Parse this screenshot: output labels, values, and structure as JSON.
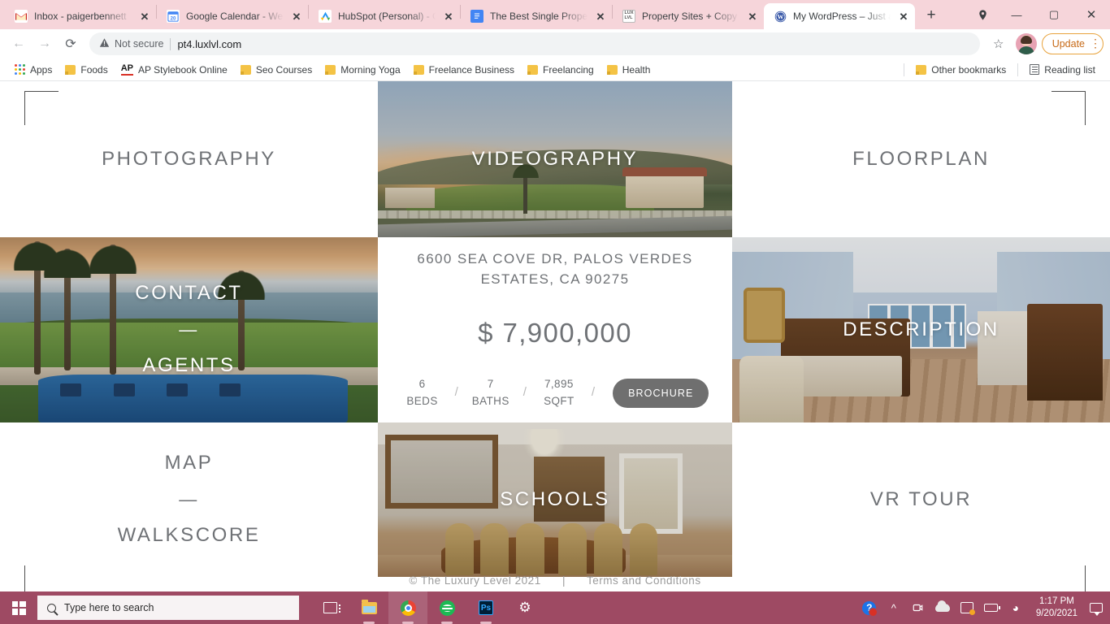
{
  "browser": {
    "tabs": [
      {
        "title": "Inbox - paigerbennett",
        "favicon": "gmail-icon",
        "active": false
      },
      {
        "title": "Google Calendar - We",
        "favicon": "google-calendar-icon",
        "active": false
      },
      {
        "title": "HubSpot (Personal) - C",
        "favicon": "hubspot-icon",
        "active": false
      },
      {
        "title": "The Best Single Proper",
        "favicon": "google-docs-icon",
        "active": false
      },
      {
        "title": "Property Sites + Copy",
        "favicon": "luxlvl-icon",
        "active": false
      },
      {
        "title": "My WordPress – Just a",
        "favicon": "wordpress-icon",
        "active": true
      }
    ],
    "new_tab_label": "+",
    "close_label": "✕",
    "window_controls": {
      "minimize": "—",
      "maximize": "▢",
      "close": "✕",
      "search_tabs": "⌄"
    },
    "toolbar": {
      "back": "←",
      "forward": "→",
      "reload": "⟳",
      "security_label": "Not secure",
      "url": "pt4.luxlvl.com",
      "bookmark_star": "☆",
      "update_label": "Update",
      "menu": "⋮"
    },
    "bookmarks": {
      "apps_label": "Apps",
      "items": [
        {
          "label": "Foods",
          "icon": "folder-icon"
        },
        {
          "label": "AP Stylebook Online",
          "icon": "ap-icon"
        },
        {
          "label": "Seo Courses",
          "icon": "folder-icon"
        },
        {
          "label": "Morning Yoga",
          "icon": "folder-icon"
        },
        {
          "label": "Freelance Business",
          "icon": "folder-icon"
        },
        {
          "label": "Freelancing",
          "icon": "folder-icon"
        },
        {
          "label": "Health",
          "icon": "folder-icon"
        }
      ],
      "other_bookmarks": "Other bookmarks",
      "reading_list": "Reading list"
    }
  },
  "page": {
    "tiles": {
      "photography": "PHOTOGRAPHY",
      "videography": "VIDEOGRAPHY",
      "floorplan": "FLOORPLAN",
      "contact": "CONTACT",
      "agents": "AGENTS",
      "description": "DESCRIPTION",
      "map": "MAP",
      "walkscore": "WALKSCORE",
      "schools": "SCHOOLS",
      "vrtour": "VR TOUR",
      "divider": "—"
    },
    "listing": {
      "address": "6600 SEA COVE DR, PALOS VERDES ESTATES, CA 90275",
      "price": "$ 7,900,000",
      "beds_value": "6",
      "beds_label": "BEDS",
      "baths_value": "7",
      "baths_label": "BATHS",
      "sqft_value": "7,895",
      "sqft_label": "SQFT",
      "separator": "/",
      "brochure_label": "BROCHURE"
    },
    "footer": {
      "copyright": "© The Luxury Level 2021",
      "separator": "|",
      "terms": "Terms and Conditions"
    }
  },
  "taskbar": {
    "start_label": "Start",
    "search_placeholder": "Type here to search",
    "pinned": [
      {
        "name": "task-view",
        "label": "Task View"
      },
      {
        "name": "file-explorer",
        "label": "File Explorer"
      },
      {
        "name": "google-chrome",
        "label": "Google Chrome"
      },
      {
        "name": "spotify",
        "label": "Spotify"
      },
      {
        "name": "photoshop",
        "label": "Adobe Photoshop"
      },
      {
        "name": "settings",
        "label": "Settings"
      }
    ],
    "tray": {
      "help": "?",
      "chevron": "^",
      "time": "1:17 PM",
      "date": "9/20/2021"
    }
  },
  "colors": {
    "chrome_theme": "#f6d5da",
    "taskbar": "#9e4a63",
    "update_accent": "#c76a17",
    "text_muted": "#6f7276",
    "brochure_bg": "#6f6f6f"
  }
}
